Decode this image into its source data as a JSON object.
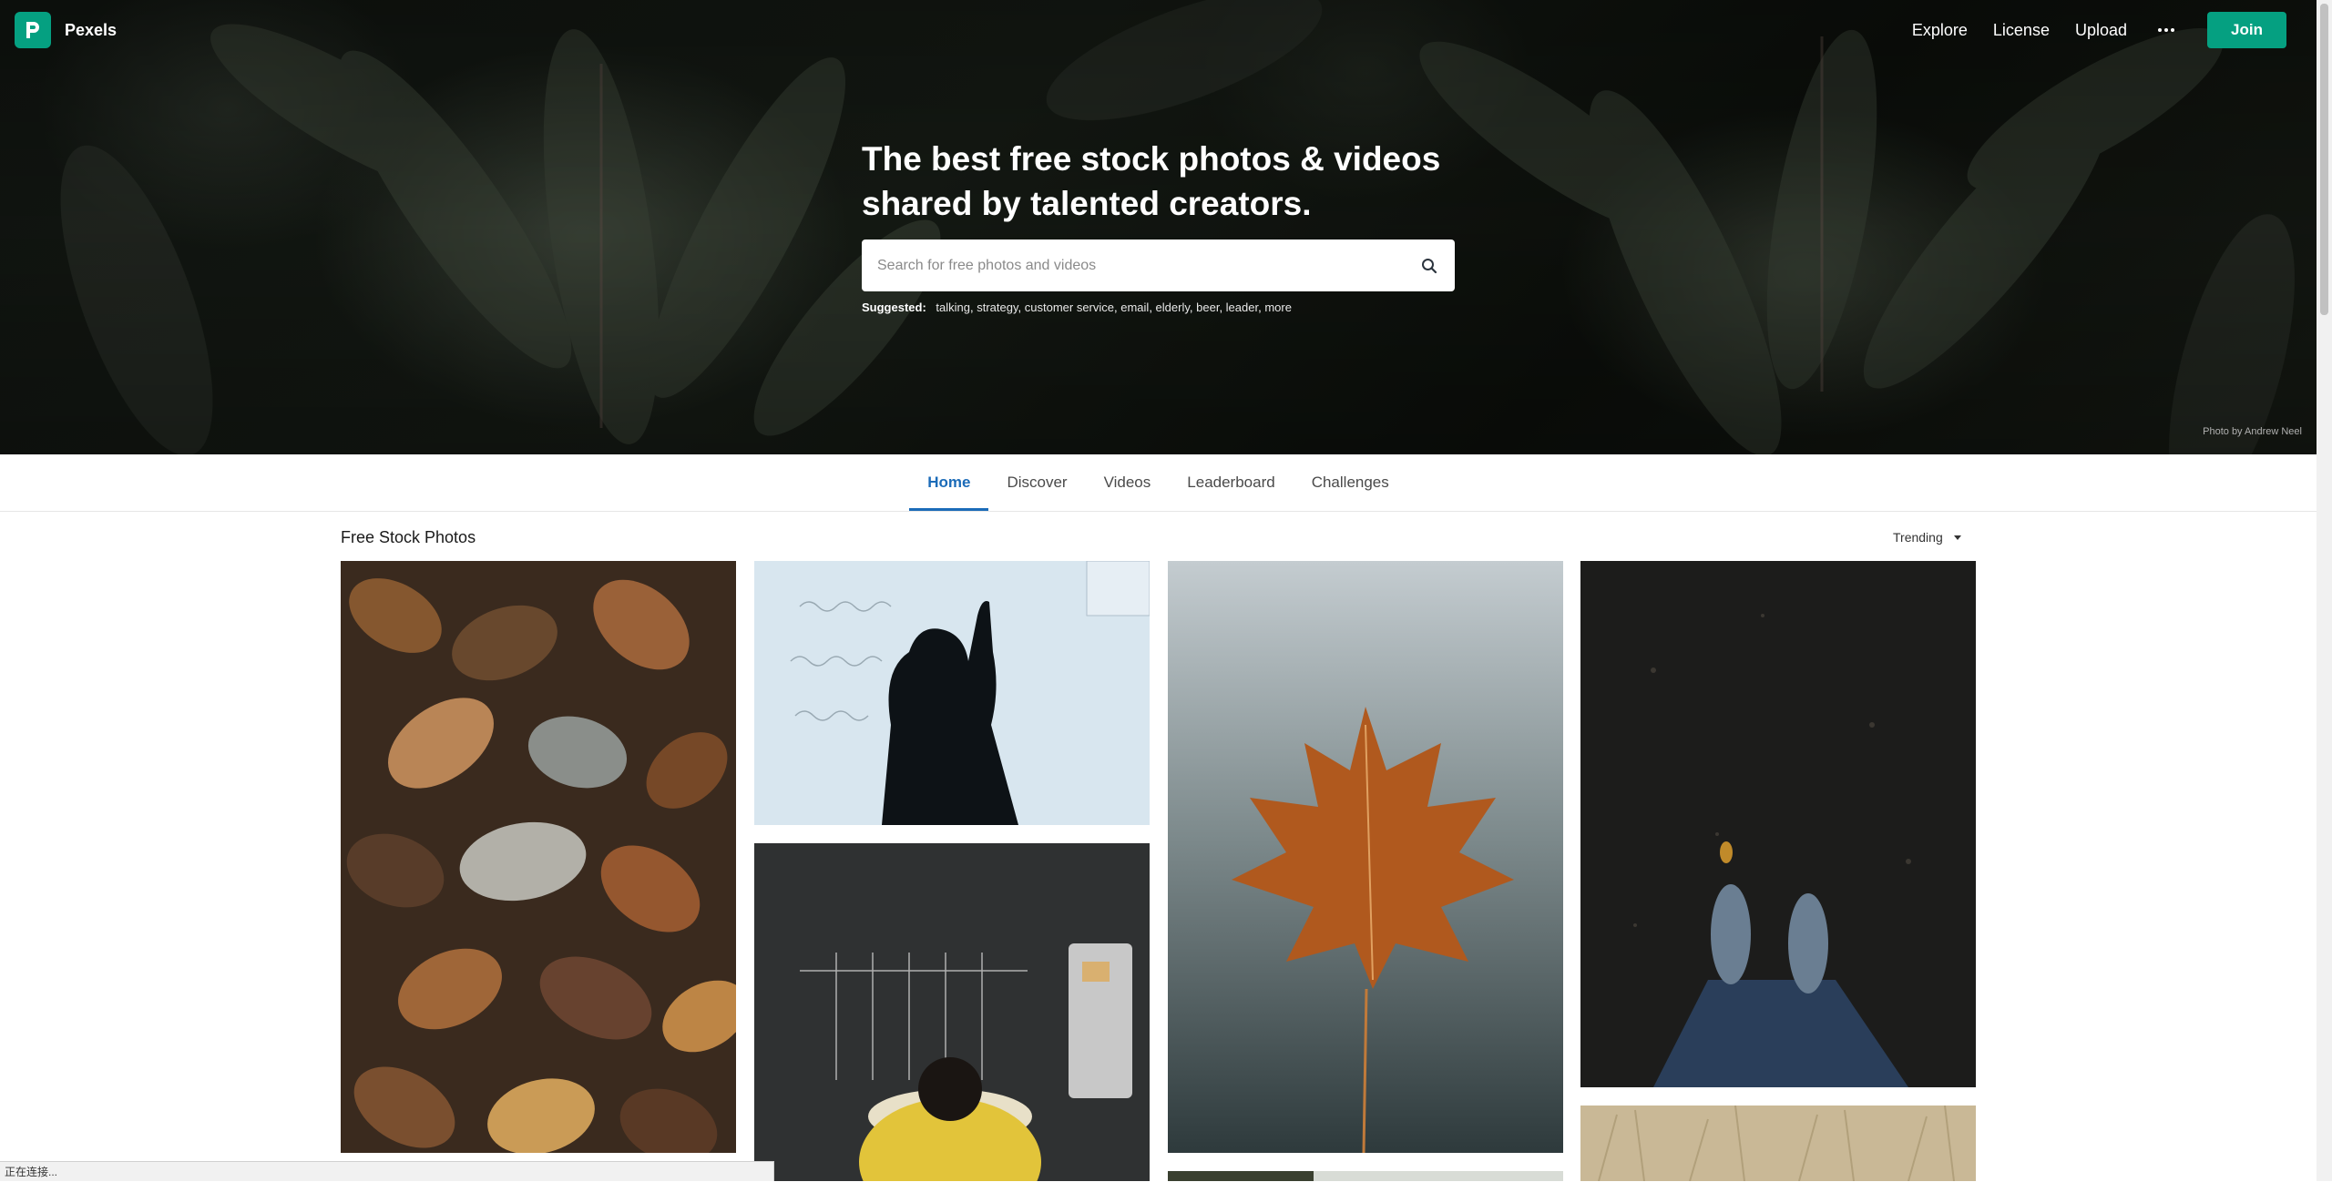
{
  "brand": {
    "name": "Pexels"
  },
  "nav": {
    "links": [
      {
        "label": "Explore"
      },
      {
        "label": "License"
      },
      {
        "label": "Upload"
      }
    ],
    "more_icon": "more-horizontal-icon",
    "join_label": "Join"
  },
  "hero": {
    "title_line1": "The best free stock photos & videos",
    "title_line2": "shared by talented creators.",
    "search_placeholder": "Search for free photos and videos",
    "suggested_label": "Suggested:",
    "suggested_tags": [
      "talking",
      "strategy",
      "customer service",
      "email",
      "elderly",
      "beer",
      "leader",
      "more"
    ],
    "photo_credit": "Photo by Andrew Neel"
  },
  "tabs": [
    {
      "label": "Home",
      "active": true
    },
    {
      "label": "Discover"
    },
    {
      "label": "Videos"
    },
    {
      "label": "Leaderboard"
    },
    {
      "label": "Challenges"
    }
  ],
  "section": {
    "title": "Free Stock Photos",
    "sort_label": "Trending"
  },
  "photos": [
    {
      "subject": "autumn leaves on ground"
    },
    {
      "subject": "woman writing equations on whiteboard"
    },
    {
      "subject": "maple leaf held against lake"
    },
    {
      "subject": "feet in sneakers on asphalt"
    },
    {
      "subject": "person at chalkboard calendar"
    },
    {
      "subject": "dry grass field"
    },
    {
      "subject": "forest"
    }
  ],
  "status_bar": {
    "text": "正在连接..."
  },
  "colors": {
    "accent": "#05a081",
    "tab_active": "#1b6bb8"
  }
}
